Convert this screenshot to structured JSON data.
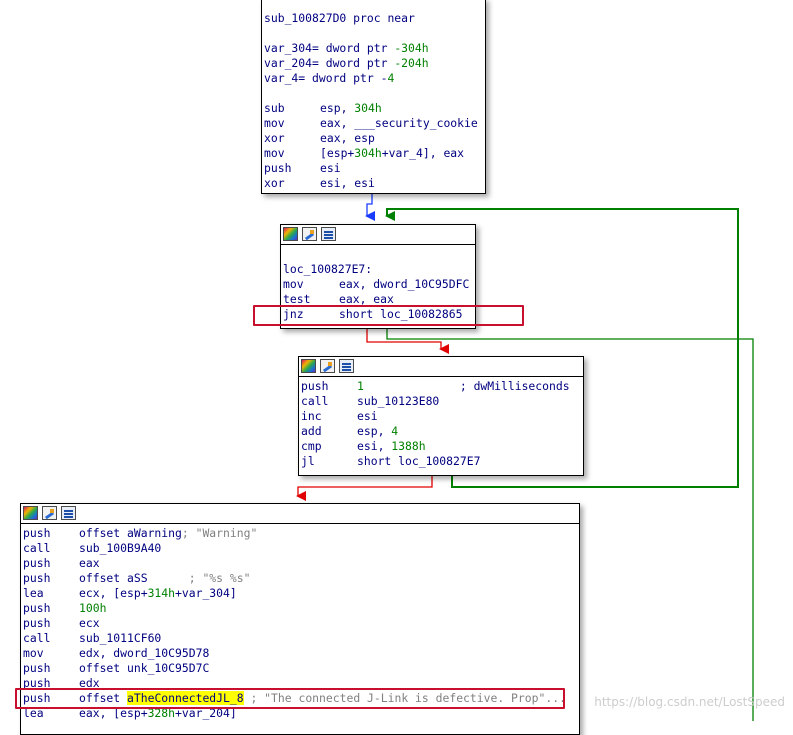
{
  "colors": {
    "edge_false": "#e00000",
    "edge_true": "#008000",
    "edge_uncond": "#1a3cff",
    "highlight_box": "#c8102e",
    "operand_number": "#008000",
    "mnemonic": "#000080"
  },
  "blocks": {
    "block1": {
      "lines": [
        {
          "mn": "sub_100827D0 proc near",
          "op": "",
          "cm": ""
        },
        {
          "mn": "",
          "op": "",
          "cm": ""
        },
        {
          "mn": "var_304= dword ptr -304h",
          "op": "",
          "cm": ""
        },
        {
          "mn": "var_204= dword ptr -204h",
          "op": "",
          "cm": ""
        },
        {
          "mn": "var_4= dword ptr -4",
          "op": "",
          "cm": ""
        },
        {
          "mn": "",
          "op": "",
          "cm": ""
        },
        {
          "mn": "sub",
          "op": "esp, 304h",
          "cm": ""
        },
        {
          "mn": "mov",
          "op": "eax, ___security_cookie",
          "cm": ""
        },
        {
          "mn": "xor",
          "op": "eax, esp",
          "cm": ""
        },
        {
          "mn": "mov",
          "op": "[esp+304h+var_4], eax",
          "cm": ""
        },
        {
          "mn": "push",
          "op": "esi",
          "cm": ""
        },
        {
          "mn": "xor",
          "op": "esi, esi",
          "cm": ""
        }
      ]
    },
    "block2": {
      "lines": [
        {
          "mn": "",
          "op": "",
          "cm": ""
        },
        {
          "mn": "loc_100827E7:",
          "op": "",
          "cm": ""
        },
        {
          "mn": "mov",
          "op": "eax, dword_10C95DFC",
          "cm": ""
        },
        {
          "mn": "test",
          "op": "eax, eax",
          "cm": ""
        },
        {
          "mn": "jnz",
          "op": "short loc_10082865",
          "cm": ""
        }
      ]
    },
    "block3": {
      "lines": [
        {
          "mn": "push",
          "op": "1",
          "cm": "; dwMilliseconds"
        },
        {
          "mn": "call",
          "op": "sub_10123E80",
          "cm": ""
        },
        {
          "mn": "inc",
          "op": "esi",
          "cm": ""
        },
        {
          "mn": "add",
          "op": "esp, 4",
          "cm": ""
        },
        {
          "mn": "cmp",
          "op": "esi, 1388h",
          "cm": ""
        },
        {
          "mn": "jl",
          "op": "short loc_100827E7",
          "cm": ""
        }
      ]
    },
    "block4": {
      "lines": [
        {
          "mn": "push",
          "op": "offset aWarning",
          "cm": "; \"Warning\""
        },
        {
          "mn": "call",
          "op": "sub_100B9A40",
          "cm": ""
        },
        {
          "mn": "push",
          "op": "eax",
          "cm": ""
        },
        {
          "mn": "push",
          "op": "offset aSS",
          "cm": "      ; \"%s %s\""
        },
        {
          "mn": "lea",
          "op": "ecx, [esp+314h+var_304]",
          "cm": ""
        },
        {
          "mn": "push",
          "op": "100h",
          "cm": ""
        },
        {
          "mn": "push",
          "op": "ecx",
          "cm": ""
        },
        {
          "mn": "call",
          "op": "sub_1011CF60",
          "cm": ""
        },
        {
          "mn": "mov",
          "op": "edx, dword_10C95D78",
          "cm": ""
        },
        {
          "mn": "push",
          "op": "offset unk_10C95D7C",
          "cm": ""
        },
        {
          "mn": "push",
          "op": "edx",
          "cm": ""
        },
        {
          "mn": "push",
          "op": "offset aTheConnectedJL_8",
          "cm": " ; \"The connected J-Link is defective. Prop\"..."
        },
        {
          "mn": "lea",
          "op": "eax, [esp+328h+var_204]",
          "cm": ""
        }
      ]
    }
  },
  "watermark": "https://blog.csdn.net/LostSpeed"
}
